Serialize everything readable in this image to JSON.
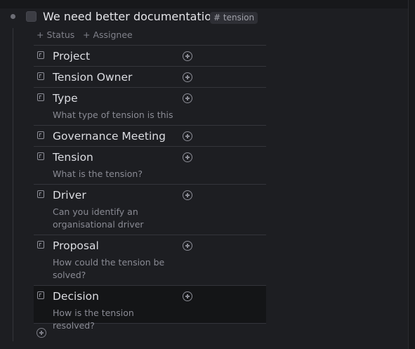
{
  "block": {
    "title": "We need better documentation",
    "tag": "# tension",
    "status_link": "+ Status",
    "assignee_link": "+ Assignee"
  },
  "properties": [
    {
      "name": "Project",
      "description": ""
    },
    {
      "name": "Tension Owner",
      "description": ""
    },
    {
      "name": "Type",
      "description": "What type of tension is this"
    },
    {
      "name": "Governance Meeting",
      "description": ""
    },
    {
      "name": "Tension",
      "description": "What is the tension?"
    },
    {
      "name": "Driver",
      "description": "Can you identify an organisational driver"
    },
    {
      "name": "Proposal",
      "description": "How could the tension be solved?"
    },
    {
      "name": "Decision",
      "description": "How is the tension resolved?"
    }
  ],
  "icons": {
    "bullet": "bullet-dot-icon",
    "property": "text-field-icon",
    "add": "plus-circle-icon"
  },
  "colors": {
    "background": "#1d1e22",
    "active_row": "#141517",
    "text": "#dcdde2",
    "muted": "#8a8b94"
  }
}
